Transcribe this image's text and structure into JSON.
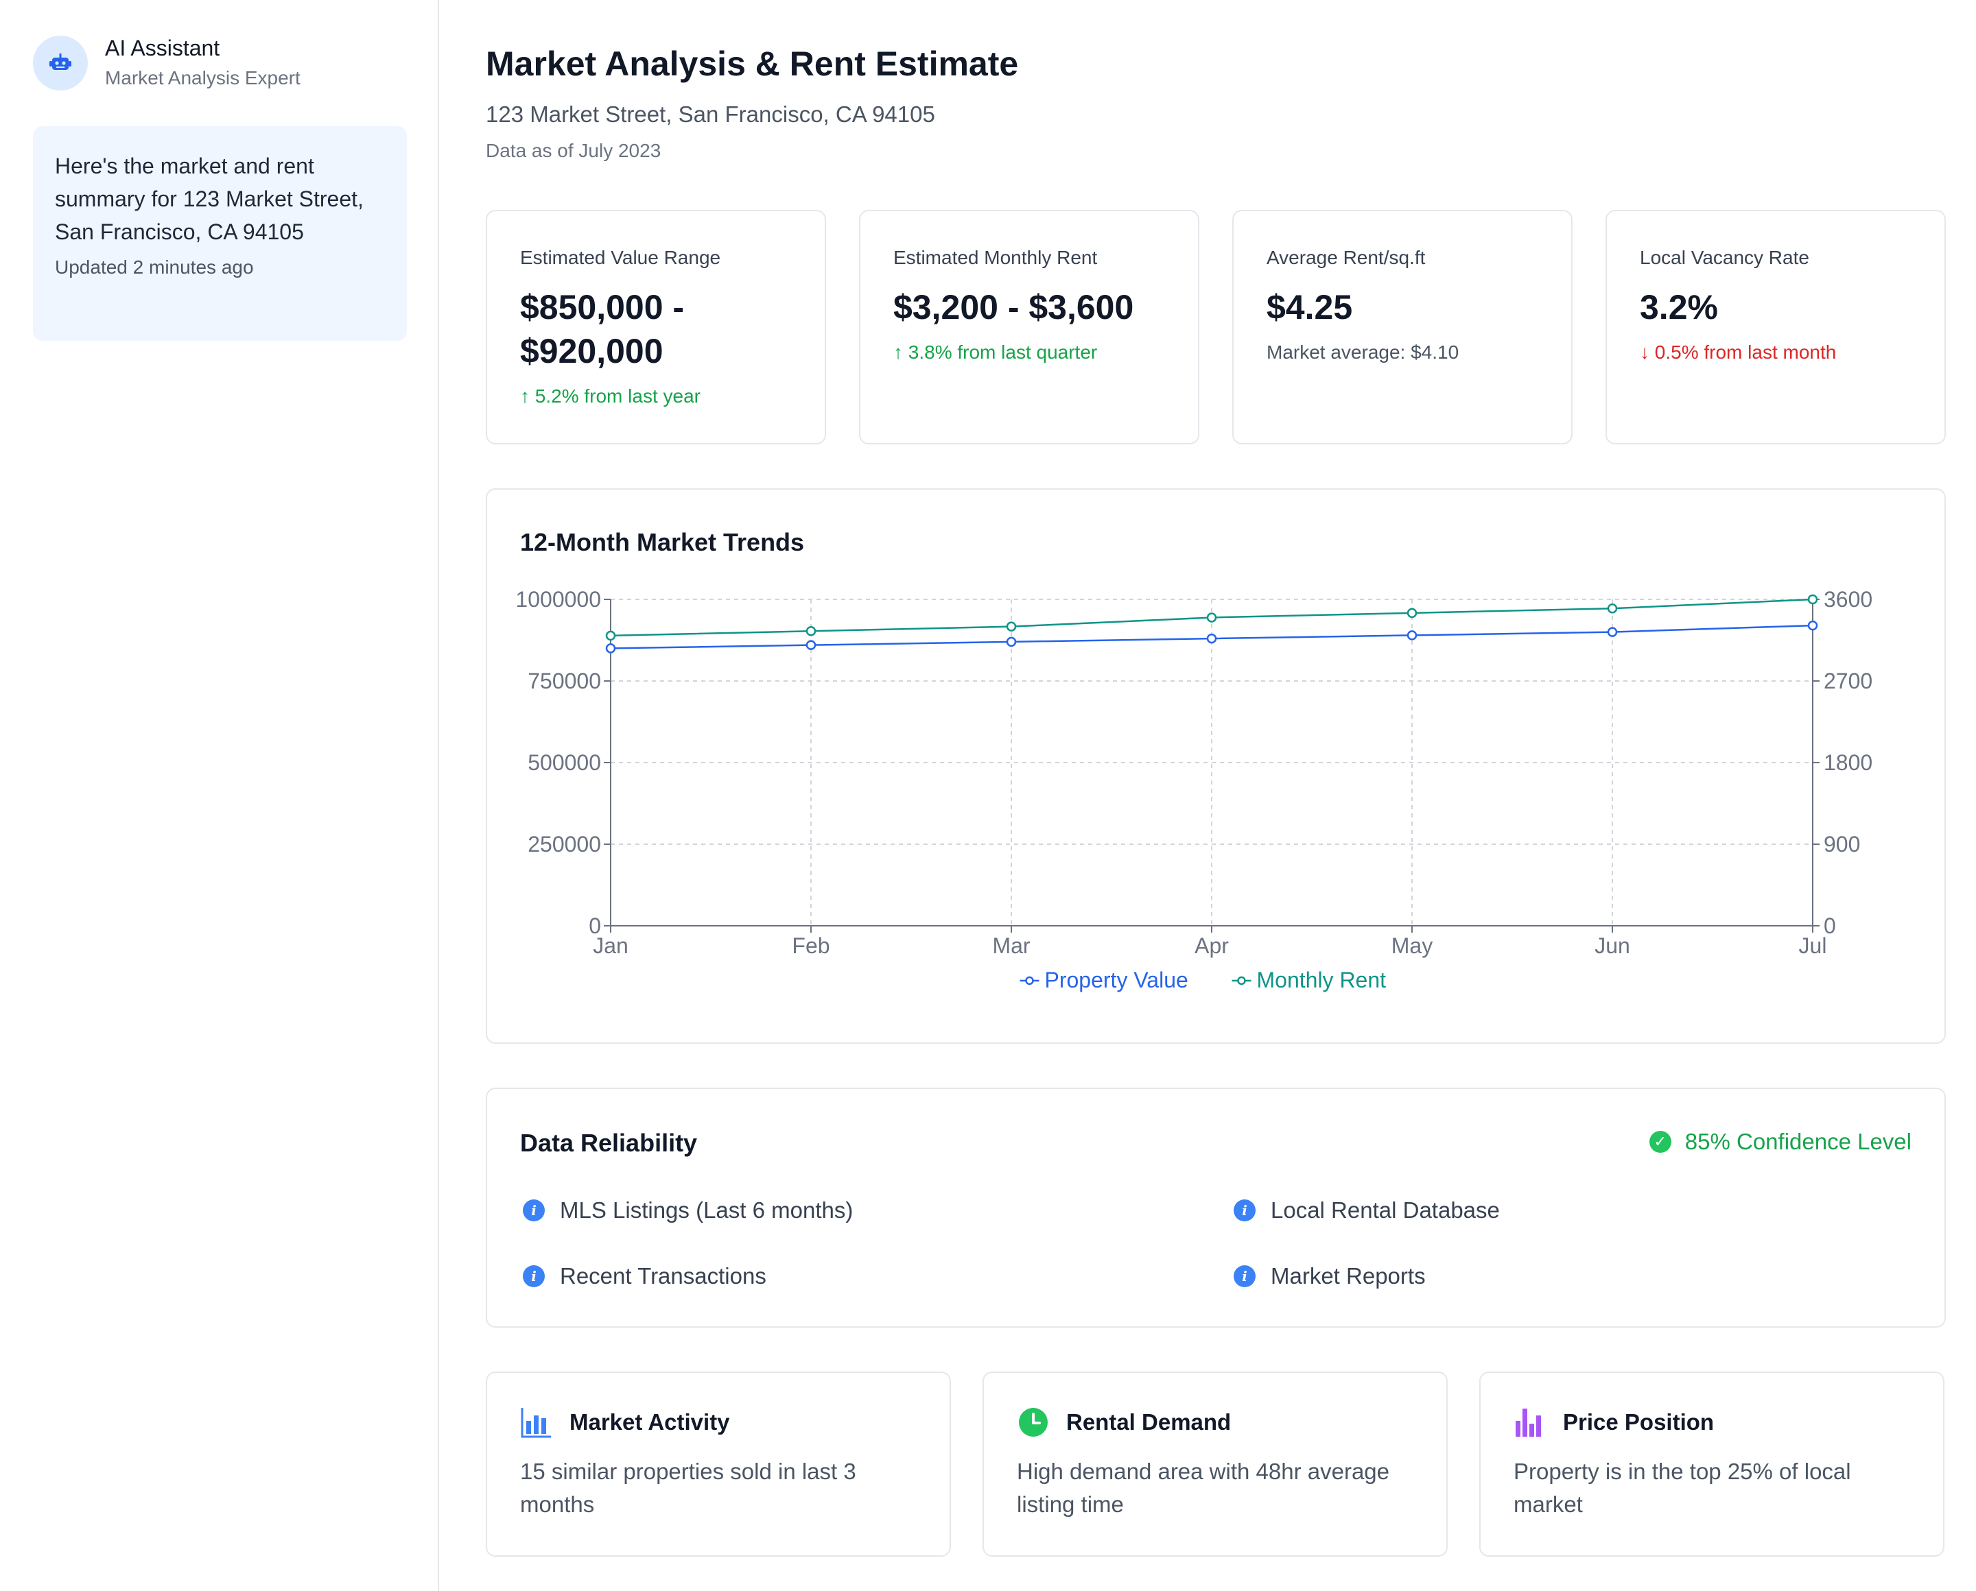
{
  "assistant": {
    "name": "AI Assistant",
    "role": "Market Analysis Expert",
    "message": "Here's the market and rent summary for 123 Market Street, San Francisco, CA 94105",
    "updated": "Updated 2 minutes ago"
  },
  "header": {
    "title": "Market Analysis & Rent Estimate",
    "address": "123 Market Street, San Francisco, CA 94105",
    "date": "Data as of July 2023"
  },
  "stats": [
    {
      "label": "Estimated Value Range",
      "value_line1": "$850,000 -",
      "value_line2": "$920,000",
      "note": "↑ 5.2% from last year",
      "tone": "up"
    },
    {
      "label": "Estimated Monthly Rent",
      "value": "$3,200 - $3,600",
      "note": "↑ 3.8% from last quarter",
      "tone": "up"
    },
    {
      "label": "Average Rent/sq.ft",
      "value": "$4.25",
      "note": "Market average: $4.10",
      "tone": "neutral"
    },
    {
      "label": "Local Vacancy Rate",
      "value": "3.2%",
      "note": "↓ 0.5% from last month",
      "tone": "down"
    }
  ],
  "trends": {
    "title": "12-Month Market Trends"
  },
  "chart_data": {
    "type": "line",
    "x": [
      "Jan",
      "Feb",
      "Mar",
      "Apr",
      "May",
      "Jun",
      "Jul"
    ],
    "series": [
      {
        "name": "Property Value",
        "axis": "left",
        "color": "#2563eb",
        "values": [
          850000,
          860000,
          870000,
          880000,
          890000,
          900000,
          920000
        ]
      },
      {
        "name": "Monthly Rent",
        "axis": "right",
        "color": "#0d9488",
        "values": [
          3200,
          3250,
          3300,
          3400,
          3450,
          3500,
          3600
        ]
      }
    ],
    "y_left": {
      "ticks": [
        "0",
        "250000",
        "500000",
        "750000",
        "1000000"
      ],
      "ylim": [
        0,
        1000000
      ]
    },
    "y_right": {
      "ticks": [
        "0",
        "900",
        "1800",
        "2700",
        "3600"
      ],
      "ylim": [
        0,
        3600
      ]
    },
    "grid": true,
    "legend": "bottom"
  },
  "reliability": {
    "title": "Data Reliability",
    "confidence": "85% Confidence Level",
    "sources": [
      "MLS Listings (Last 6 months)",
      "Local Rental Database",
      "Recent Transactions",
      "Market Reports"
    ]
  },
  "insights": [
    {
      "title": "Market Activity",
      "icon": "bar-chart-icon",
      "color": "#3b82f6",
      "body": "15 similar properties sold in last 3 months"
    },
    {
      "title": "Rental Demand",
      "icon": "clock-icon",
      "color": "#22c55e",
      "body": "High demand area with 48hr average listing time"
    },
    {
      "title": "Price Position",
      "icon": "price-bars-icon",
      "color": "#a855f7",
      "body": "Property is in the top 25% of local market"
    }
  ]
}
